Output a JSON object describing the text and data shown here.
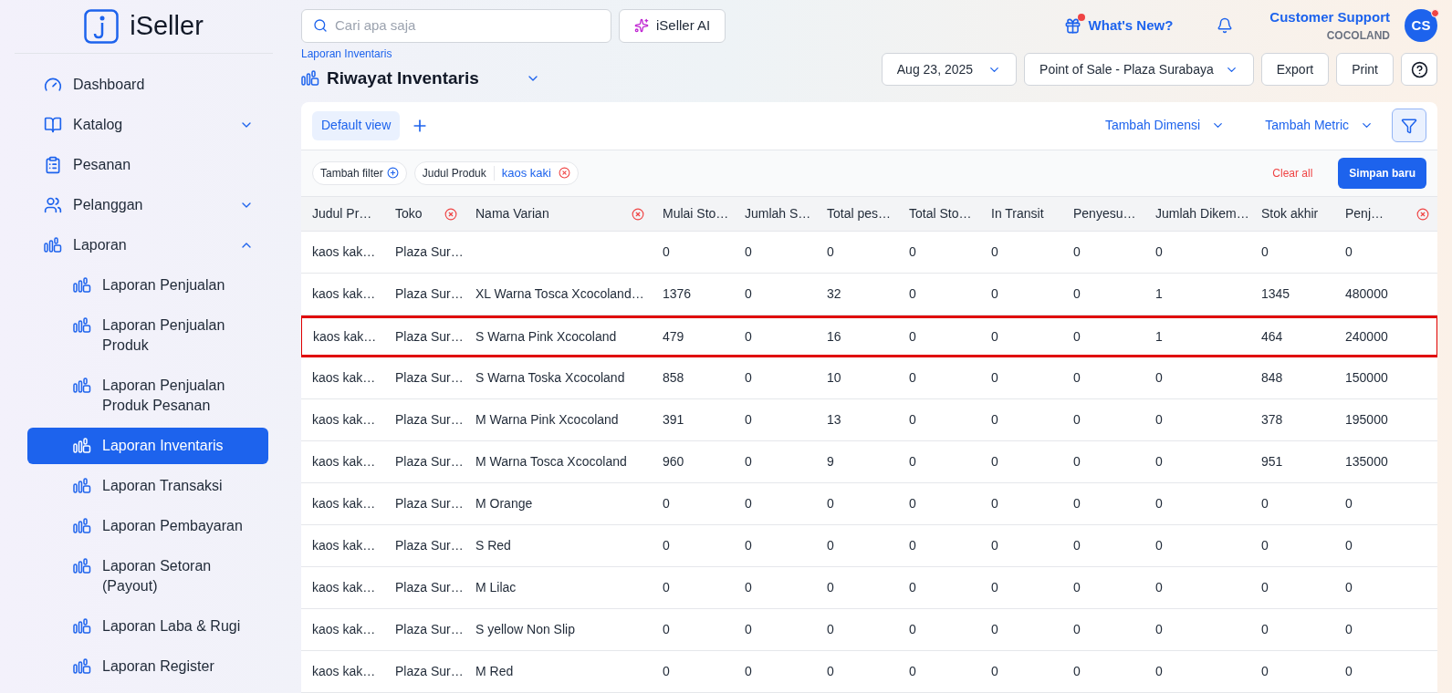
{
  "logo": {
    "text": "iSeller"
  },
  "search": {
    "placeholder": "Cari apa saja"
  },
  "ai_button": {
    "label": "iSeller AI"
  },
  "whats_new": {
    "label": "What's New?",
    "unread": true
  },
  "user": {
    "name": "Customer Support",
    "store": "COCOLAND",
    "initials": "CS",
    "unread": true
  },
  "sidebar": {
    "items": [
      {
        "label": "Dashboard",
        "selected": false
      },
      {
        "label": "Katalog",
        "selected": false,
        "expanded": false
      },
      {
        "label": "Pesanan",
        "selected": false
      },
      {
        "label": "Pelanggan",
        "selected": false,
        "expanded": false
      },
      {
        "label": "Laporan",
        "selected": false,
        "expanded": true,
        "children": [
          {
            "label": "Laporan Penjualan",
            "selected": false
          },
          {
            "label": "Laporan Penjualan Produk",
            "selected": false
          },
          {
            "label": "Laporan Penjualan Produk Pesanan",
            "selected": false
          },
          {
            "label": "Laporan Inventaris",
            "selected": true
          },
          {
            "label": "Laporan Transaksi",
            "selected": false
          },
          {
            "label": "Laporan Pembayaran",
            "selected": false
          },
          {
            "label": "Laporan Setoran (Payout)",
            "selected": false
          },
          {
            "label": "Laporan Laba & Rugi",
            "selected": false
          },
          {
            "label": "Laporan Register",
            "selected": false
          }
        ]
      }
    ]
  },
  "breadcrumb": "Laporan Inventaris",
  "page_title": "Riwayat Inventaris",
  "toolbar": {
    "date": "Aug 23, 2025",
    "outlet": "Point of Sale - Plaza Surabaya",
    "buttons": [
      "Export",
      "Print"
    ]
  },
  "views": [
    {
      "label": "Default view",
      "selected": true
    }
  ],
  "view_actions": [
    "Tambah Dimensi",
    "Tambah Metric"
  ],
  "filters": {
    "add_label": "Tambah filter",
    "chips": [
      {
        "field": "Judul Produk",
        "value": "kaos kaki"
      }
    ],
    "clear": "Clear all",
    "save": "Simpan baru"
  },
  "table": {
    "columns": [
      {
        "label": "Judul Pr…",
        "removable": false
      },
      {
        "label": "Toko",
        "removable": true
      },
      {
        "label": "Nama Varian",
        "removable": true
      },
      {
        "label": "Mulai Sto…",
        "removable": false
      },
      {
        "label": "Jumlah S…",
        "removable": false
      },
      {
        "label": "Total pes…",
        "removable": false
      },
      {
        "label": "Total Sto…",
        "removable": false
      },
      {
        "label": "In Transit",
        "removable": false
      },
      {
        "label": "Penyesu…",
        "removable": false
      },
      {
        "label": "Jumlah Dikem…",
        "removable": false
      },
      {
        "label": "Stok akhir",
        "removable": false
      },
      {
        "label": "Penj…",
        "removable": true
      }
    ],
    "rows": [
      {
        "highlighted": false,
        "cells": [
          "kaos kak…",
          "Plaza Sur…",
          "",
          "0",
          "0",
          "0",
          "0",
          "0",
          "0",
          "0",
          "0",
          "0"
        ]
      },
      {
        "highlighted": false,
        "cells": [
          "kaos kak…",
          "Plaza Sur…",
          "XL Warna Tosca Xcocoland…",
          "1376",
          "0",
          "32",
          "0",
          "0",
          "0",
          "1",
          "1345",
          "480000"
        ]
      },
      {
        "highlighted": true,
        "cells": [
          "kaos kak…",
          "Plaza Sur…",
          "S Warna Pink Xcocoland",
          "479",
          "0",
          "16",
          "0",
          "0",
          "0",
          "1",
          "464",
          "240000"
        ]
      },
      {
        "highlighted": false,
        "cells": [
          "kaos kak…",
          "Plaza Sur…",
          "S Warna Toska Xcocoland",
          "858",
          "0",
          "10",
          "0",
          "0",
          "0",
          "0",
          "848",
          "150000"
        ]
      },
      {
        "highlighted": false,
        "cells": [
          "kaos kak…",
          "Plaza Sur…",
          "M Warna Pink Xcocoland",
          "391",
          "0",
          "13",
          "0",
          "0",
          "0",
          "0",
          "378",
          "195000"
        ]
      },
      {
        "highlighted": false,
        "cells": [
          "kaos kak…",
          "Plaza Sur…",
          "M Warna Tosca Xcocoland",
          "960",
          "0",
          "9",
          "0",
          "0",
          "0",
          "0",
          "951",
          "135000"
        ]
      },
      {
        "highlighted": false,
        "cells": [
          "kaos kak…",
          "Plaza Sur…",
          "M Orange",
          "0",
          "0",
          "0",
          "0",
          "0",
          "0",
          "0",
          "0",
          "0"
        ]
      },
      {
        "highlighted": false,
        "cells": [
          "kaos kak…",
          "Plaza Sur…",
          "S Red",
          "0",
          "0",
          "0",
          "0",
          "0",
          "0",
          "0",
          "0",
          "0"
        ]
      },
      {
        "highlighted": false,
        "cells": [
          "kaos kak…",
          "Plaza Sur…",
          "M Lilac",
          "0",
          "0",
          "0",
          "0",
          "0",
          "0",
          "0",
          "0",
          "0"
        ]
      },
      {
        "highlighted": false,
        "cells": [
          "kaos kak…",
          "Plaza Sur…",
          "S yellow Non Slip",
          "0",
          "0",
          "0",
          "0",
          "0",
          "0",
          "0",
          "0",
          "0"
        ]
      },
      {
        "highlighted": false,
        "cells": [
          "kaos kak…",
          "Plaza Sur…",
          "M Red",
          "0",
          "0",
          "0",
          "0",
          "0",
          "0",
          "0",
          "0",
          "0"
        ]
      }
    ]
  }
}
